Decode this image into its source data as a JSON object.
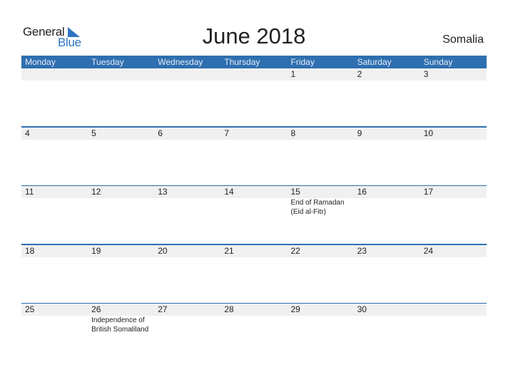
{
  "logo": {
    "text1": "General",
    "text2": "Blue",
    "brand_color": "#2e75c0"
  },
  "title": "June 2018",
  "country": "Somalia",
  "header_color": "#2e6fb0",
  "weekdays": [
    "Monday",
    "Tuesday",
    "Wednesday",
    "Thursday",
    "Friday",
    "Saturday",
    "Sunday"
  ],
  "weeks": [
    [
      {
        "day": ""
      },
      {
        "day": ""
      },
      {
        "day": ""
      },
      {
        "day": ""
      },
      {
        "day": "1"
      },
      {
        "day": "2"
      },
      {
        "day": "3"
      }
    ],
    [
      {
        "day": "4"
      },
      {
        "day": "5"
      },
      {
        "day": "6"
      },
      {
        "day": "7"
      },
      {
        "day": "8"
      },
      {
        "day": "9"
      },
      {
        "day": "10"
      }
    ],
    [
      {
        "day": "11"
      },
      {
        "day": "12"
      },
      {
        "day": "13"
      },
      {
        "day": "14"
      },
      {
        "day": "15",
        "holiday": [
          "End of Ramadan",
          "(Eid al-Fitr)"
        ]
      },
      {
        "day": "16"
      },
      {
        "day": "17"
      }
    ],
    [
      {
        "day": "18"
      },
      {
        "day": "19"
      },
      {
        "day": "20"
      },
      {
        "day": "21"
      },
      {
        "day": "22"
      },
      {
        "day": "23"
      },
      {
        "day": "24"
      }
    ],
    [
      {
        "day": "25"
      },
      {
        "day": "26",
        "holiday": [
          "Independence of",
          "British Somaliland"
        ]
      },
      {
        "day": "27"
      },
      {
        "day": "28"
      },
      {
        "day": "29"
      },
      {
        "day": "30"
      },
      {
        "day": ""
      }
    ]
  ]
}
